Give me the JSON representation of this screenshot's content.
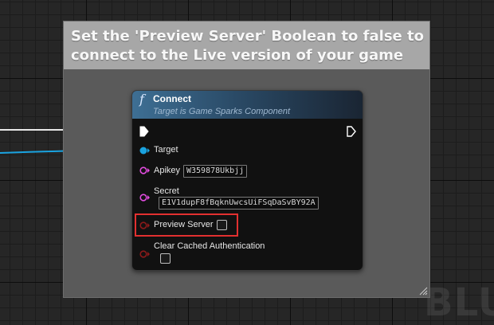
{
  "comment": {
    "text": "Set the 'Preview Server' Boolean to false to connect to the Live version of your game"
  },
  "node": {
    "icon": "function-icon",
    "title": "Connect",
    "subtitle": "Target is Game Sparks Component",
    "pins": {
      "target_label": "Target",
      "apikey_label": "Apikey",
      "apikey_value": "W359878Ukbjj",
      "secret_label": "Secret",
      "secret_value": "E1V1dupF8fBqknUwcsUiFSqDaSvBY92A",
      "preview_server_label": "Preview Server",
      "preview_server_checked": false,
      "clear_cache_label": "Clear Cached Authentication",
      "clear_cache_checked": false
    }
  },
  "watermark": "BLU",
  "colors": {
    "exec_wire": "#ffffff",
    "object_pin": "#1aa3e0",
    "string_pin": "#e34ce0",
    "bool_pin": "#8c1a1a",
    "highlight": "#e23030"
  }
}
